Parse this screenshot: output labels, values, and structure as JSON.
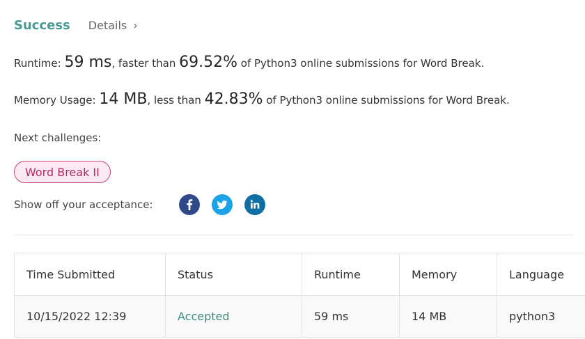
{
  "result": {
    "status": "Success",
    "details_label": "Details",
    "details_chevron": "›"
  },
  "runtime": {
    "prefix": "Runtime: ",
    "value": "59 ms",
    "middle": ", faster than ",
    "percent": "69.52%",
    "suffix": " of Python3 online submissions for Word Break."
  },
  "memory": {
    "prefix": "Memory Usage: ",
    "value": "14 MB",
    "middle": ", less than ",
    "percent": "42.83%",
    "suffix": " of Python3 online submissions for Word Break."
  },
  "next": {
    "label": "Next challenges:",
    "challenges": [
      "Word Break II"
    ]
  },
  "share": {
    "label": "Show off your acceptance:",
    "icons": [
      "facebook-icon",
      "twitter-icon",
      "linkedin-icon"
    ]
  },
  "table": {
    "headers": [
      "Time Submitted",
      "Status",
      "Runtime",
      "Memory",
      "Language"
    ],
    "rows": [
      [
        "10/15/2022 12:39",
        "Accepted",
        "59 ms",
        "14 MB",
        "python3"
      ]
    ]
  },
  "colors": {
    "success": "#4a9a94",
    "accepted": "#3d8d7f",
    "pill_border": "#c7427a",
    "pill_bg": "#fde9f1",
    "facebook": "#2f4a8a",
    "twitter": "#1ca2e6",
    "linkedin": "#0f6fa5"
  }
}
